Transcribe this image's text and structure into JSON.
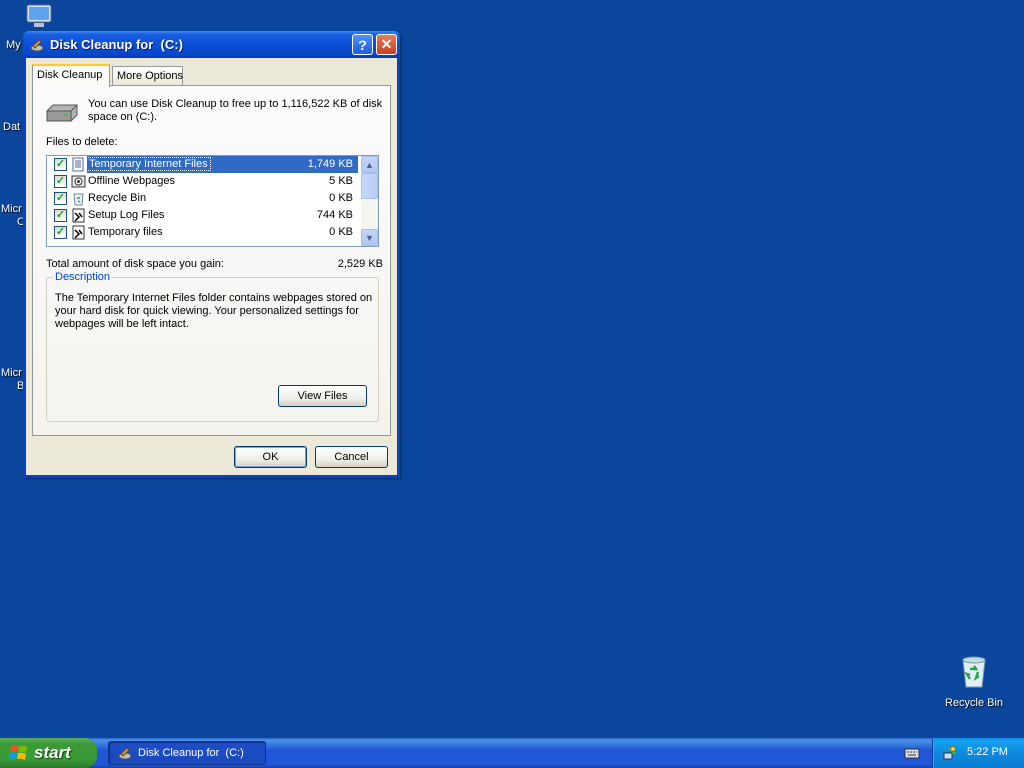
{
  "desktop": {
    "icons": [
      {
        "label": "My",
        "icon": "my-computer-icon"
      },
      {
        "label": "Dat"
      },
      {
        "label": "Micr",
        "label2": "C"
      },
      {
        "label": "Micr",
        "label2": "B"
      }
    ],
    "recycle_bin": {
      "label": "Recycle Bin",
      "icon": "recycle-bin-icon"
    }
  },
  "dialog": {
    "title": "Disk Cleanup for  (C:)",
    "help_button": "?",
    "close_button": "✕",
    "tabs": [
      {
        "label": "Disk Cleanup",
        "active": true
      },
      {
        "label": "More Options",
        "active": false
      }
    ],
    "intro_text": "You can use Disk Cleanup to free up to 1,116,522 KB of disk space on  (C:).",
    "files_label": "Files to delete:",
    "files": [
      {
        "label": "Temporary Internet Files",
        "size": "1,749 KB",
        "checked": true,
        "selected": true,
        "icon": "document-icon"
      },
      {
        "label": "Offline Webpages",
        "size": "5 KB",
        "checked": true,
        "selected": false,
        "icon": "offline-webpages-icon"
      },
      {
        "label": "Recycle Bin",
        "size": "0 KB",
        "checked": true,
        "selected": false,
        "icon": "recycle-bin-icon"
      },
      {
        "label": "Setup Log Files",
        "size": "744 KB",
        "checked": true,
        "selected": false,
        "icon": "log-file-icon"
      },
      {
        "label": "Temporary files",
        "size": "0 KB",
        "checked": true,
        "selected": false,
        "icon": "temp-file-icon"
      }
    ],
    "total_label": "Total amount of disk space you gain:",
    "total_value": "2,529 KB",
    "description_title": "Description",
    "description_text": "The Temporary Internet Files folder contains webpages stored on your hard disk for quick viewing. Your personalized settings for webpages will be left intact.",
    "view_files_label": "View Files",
    "ok_label": "OK",
    "cancel_label": "Cancel"
  },
  "taskbar": {
    "start_label": "start",
    "task_button_label": "Disk Cleanup for  (C:)",
    "clock": "5:22 PM"
  },
  "colors": {
    "desktop": "#0a469c",
    "titlebar": "#0a4fd6",
    "selection": "#316ac5",
    "start_green": "#3c9a3a",
    "groupbox_title": "#0046d5"
  }
}
